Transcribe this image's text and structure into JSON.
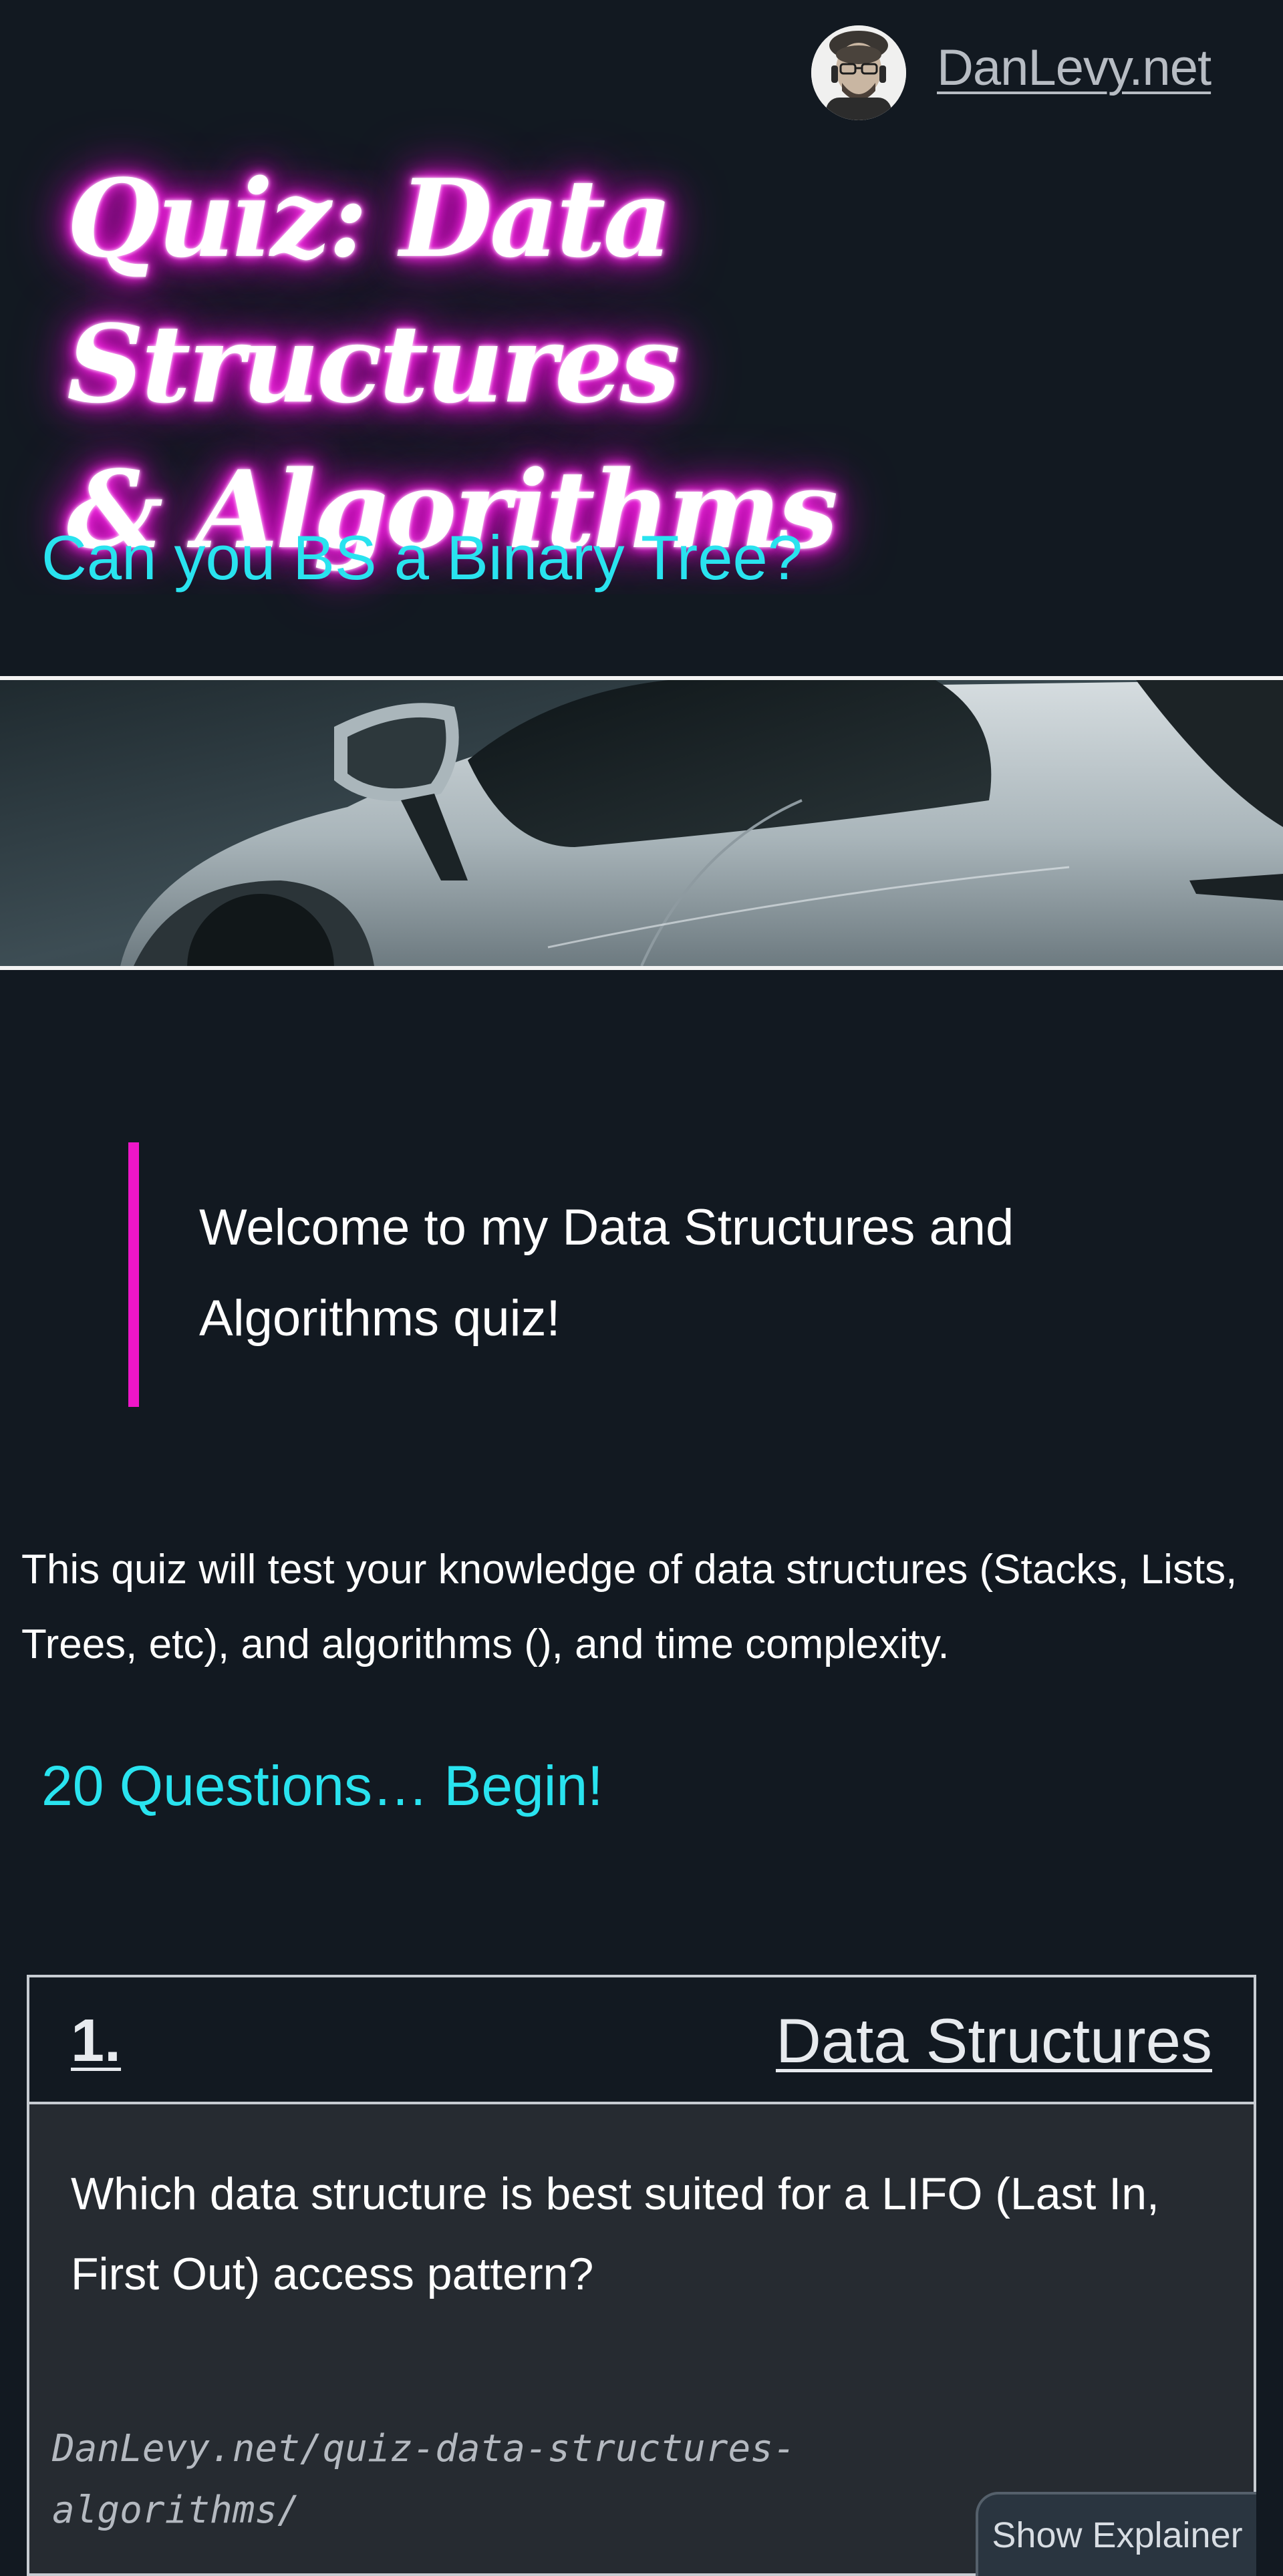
{
  "header": {
    "site_name": "DanLevy.net",
    "avatar_icon": "author-avatar"
  },
  "hero": {
    "title_line1": "Quiz: Data Structures",
    "title_line2": "& Algorithms",
    "subtitle": "Can you BS a Binary Tree?",
    "title_glow_color": "#ff1fe5",
    "subtitle_color": "#29e3ef"
  },
  "banner": {
    "image": "wet silver sports car"
  },
  "intro": {
    "welcome": "Welcome to my Data Structures and Algorithms quiz!",
    "description": "This quiz will test your knowledge of data structures (Stacks, Lists, Trees, etc), and algorithms (), and time complexity.",
    "begin_link": "20 Questions… Begin!",
    "accent_color": "#ee16c8"
  },
  "question": {
    "number": "1.",
    "category": "Data Structures",
    "text": "Which data structure is best suited for a LIFO (Last In, First Out) access pattern?",
    "url": "DanLevy.net/quiz-data-structures-algorithms/",
    "explainer_button": "Show Explainer"
  }
}
